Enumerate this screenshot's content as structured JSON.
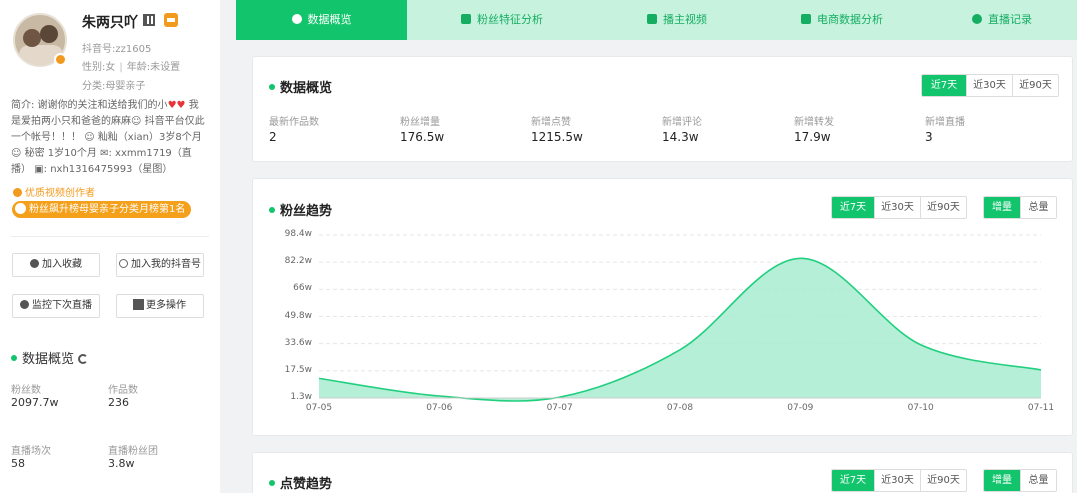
{
  "profile": {
    "nickname": "朱两只吖",
    "account": "抖音号:zz1605",
    "gender": "性别:女",
    "age": "年龄:未设置",
    "category": "分类:母婴亲子",
    "bio_1": "简介: 谢谢你的关注和送给我们的小",
    "bio_2": "我是爱拍两小只和爸爸的麻麻",
    "bio_3": "抖音平台仅此一个帐号！！！",
    "bio_4": "籼籼（xian）3岁8个月",
    "bio_5": "秘密 1岁10个月",
    "bio_6": "xxmm1719（直播）",
    "bio_7": "nxh1316475993（星图）",
    "tag_quality": "优质视频创作者",
    "tag_rank": "粉丝飙升榜母婴亲子分类月榜第1名"
  },
  "actions": {
    "collect": "加入收藏",
    "add_mine": "加入我的抖音号",
    "monitor": "监控下次直播",
    "more": "更多操作"
  },
  "side_overview": {
    "title": "数据概览",
    "fans_label": "粉丝数",
    "fans_value": "2097.7w",
    "works_label": "作品数",
    "works_value": "236",
    "live_label": "直播场次",
    "live_value": "58",
    "group_label": "直播粉丝团",
    "group_value": "3.8w"
  },
  "tabs": [
    "数据概览",
    "粉丝特征分析",
    "播主视频",
    "电商数据分析",
    "直播记录"
  ],
  "overview": {
    "title": "数据概览",
    "range": [
      "近7天",
      "近30天",
      "近90天"
    ],
    "metrics": [
      {
        "label": "最新作品数",
        "value": "2"
      },
      {
        "label": "粉丝增量",
        "value": "176.5w"
      },
      {
        "label": "新增点赞",
        "value": "1215.5w"
      },
      {
        "label": "新增评论",
        "value": "14.3w"
      },
      {
        "label": "新增转发",
        "value": "17.9w"
      },
      {
        "label": "新增直播",
        "value": "3"
      }
    ]
  },
  "fans_trend": {
    "title": "粉丝趋势",
    "range": [
      "近7天",
      "近30天",
      "近90天"
    ],
    "mode": [
      "增量",
      "总量"
    ]
  },
  "likes_trend": {
    "title": "点赞趋势",
    "range": [
      "近7天",
      "近30天",
      "近90天"
    ],
    "mode": [
      "增量",
      "总量"
    ]
  },
  "colors": {
    "accent": "#12c56d",
    "tab_bg": "#c7f3de",
    "area": "#a8ecd0",
    "line": "#21cf7f",
    "badge": "#f29a1d"
  },
  "chart_data": {
    "type": "area",
    "x": [
      "07-05",
      "07-06",
      "07-07",
      "07-08",
      "07-09",
      "07-10",
      "07-11"
    ],
    "y_ticks": [
      "98.4w",
      "82.2w",
      "66w",
      "49.8w",
      "33.6w",
      "17.5w",
      "1.3w"
    ],
    "ylim": [
      1.3,
      98.4
    ],
    "series": [
      {
        "values": [
          13.0,
          2.5,
          1.8,
          30.0,
          84.5,
          33.0,
          18.0
        ]
      }
    ],
    "grid": true
  }
}
